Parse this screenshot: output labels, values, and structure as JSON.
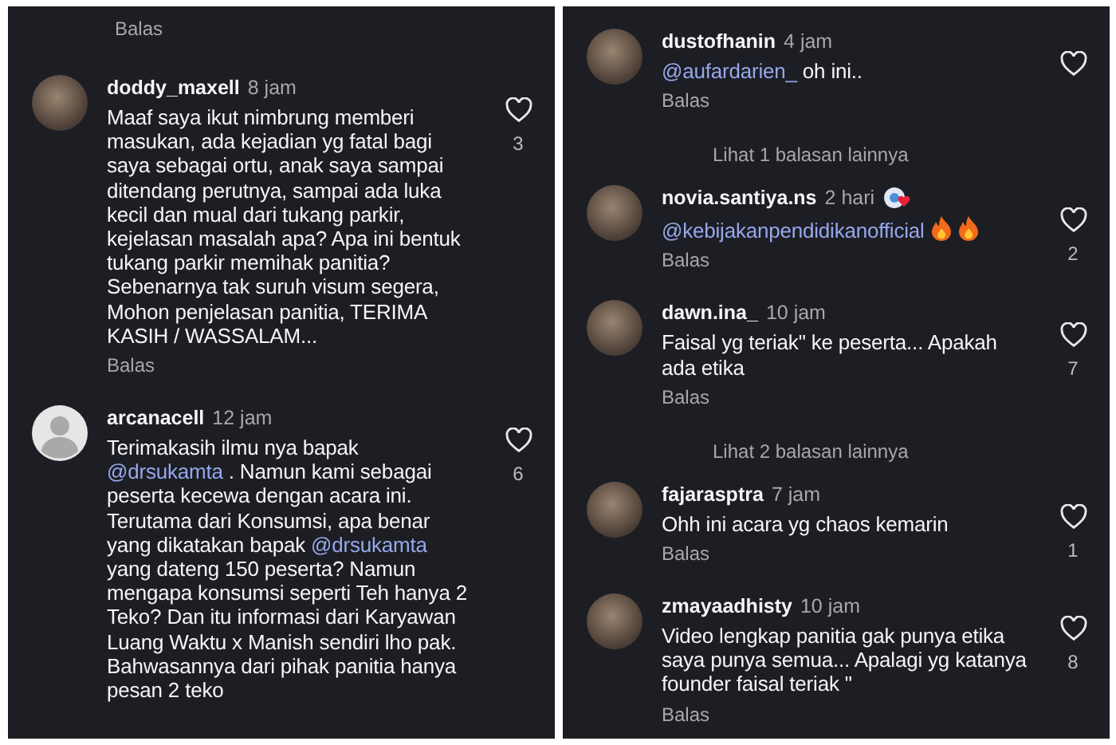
{
  "panels": [
    {
      "items": [
        {
          "kind": "reply_link",
          "label": "Balas"
        },
        {
          "kind": "comment",
          "has_photo": true,
          "username": "doddy_maxell",
          "time": "8 jam",
          "parts": [
            {
              "kind": "text",
              "text": "Maaf saya ikut nimbrung memberi masukan, ada kejadian yg fatal bagi saya sebagai ortu, anak saya sampai ditendang perutnya, sampai ada luka kecil dan mual dari tukang parkir, kejelasan masalah apa? Apa ini bentuk tukang parkir memihak panitia?\nSebenarnya tak suruh visum segera, Mohon penjelasan panitia, TERIMA KASIH / WASSALAM..."
            }
          ],
          "reply": "Balas",
          "liked": false,
          "likes": "3"
        },
        {
          "kind": "comment",
          "has_photo": false,
          "username": "arcanacell",
          "time": "12 jam",
          "parts": [
            {
              "kind": "text",
              "text": "Terimakasih ilmu nya bapak "
            },
            {
              "kind": "mention",
              "text": "@drsukamta"
            },
            {
              "kind": "text",
              "text": " . Namun kami sebagai peserta kecewa dengan acara ini. Terutama dari Konsumsi, apa benar yang dikatakan bapak "
            },
            {
              "kind": "mention",
              "text": "@drsukamta"
            },
            {
              "kind": "text",
              "text": " yang dateng 150 peserta? Namun mengapa konsumsi seperti Teh hanya 2 Teko? Dan itu informasi dari Karyawan Luang Waktu x Manish sendiri lho pak. Bahwasannya dari pihak panitia hanya pesan 2 teko"
            }
          ],
          "liked": false,
          "likes": "6"
        }
      ]
    },
    {
      "items": [
        {
          "kind": "comment",
          "has_photo": true,
          "username": "dustofhanin",
          "time": "4 jam",
          "parts": [
            {
              "kind": "mention",
              "text": "@aufardarien_"
            },
            {
              "kind": "text",
              "text": " oh ini.."
            }
          ],
          "reply": "Balas",
          "liked": false
        },
        {
          "kind": "more_replies",
          "label": "Lihat 1 balasan lainnya"
        },
        {
          "kind": "comment",
          "has_photo": true,
          "username": "novia.santiya.ns",
          "time": "2 hari",
          "badge": true,
          "parts": [
            {
              "kind": "mention",
              "text": "@kebijakanpendidikanofficial"
            },
            {
              "kind": "fire"
            },
            {
              "kind": "fire"
            }
          ],
          "reply": "Balas",
          "liked": false,
          "likes": "2"
        },
        {
          "kind": "comment",
          "has_photo": true,
          "username": "dawn.ina_",
          "time": "10 jam",
          "parts": [
            {
              "kind": "text",
              "text": "Faisal yg teriak\" ke peserta... Apakah ada etika"
            }
          ],
          "reply": "Balas",
          "liked": false,
          "likes": "7"
        },
        {
          "kind": "more_replies",
          "label": "Lihat 2 balasan lainnya"
        },
        {
          "kind": "comment",
          "has_photo": true,
          "username": "fajarasptra",
          "time": "7 jam",
          "parts": [
            {
              "kind": "text",
              "text": "Ohh ini acara yg chaos kemarin"
            }
          ],
          "reply": "Balas",
          "liked": false,
          "likes": "1"
        },
        {
          "kind": "comment",
          "has_photo": true,
          "username": "zmayaadhisty",
          "time": "10 jam",
          "parts": [
            {
              "kind": "text",
              "text": "Video lengkap panitia gak punya etika saya punya semua... Apalagi yg katanya founder faisal teriak \""
            }
          ],
          "reply": "Balas",
          "liked": false,
          "likes": "8"
        }
      ]
    }
  ]
}
